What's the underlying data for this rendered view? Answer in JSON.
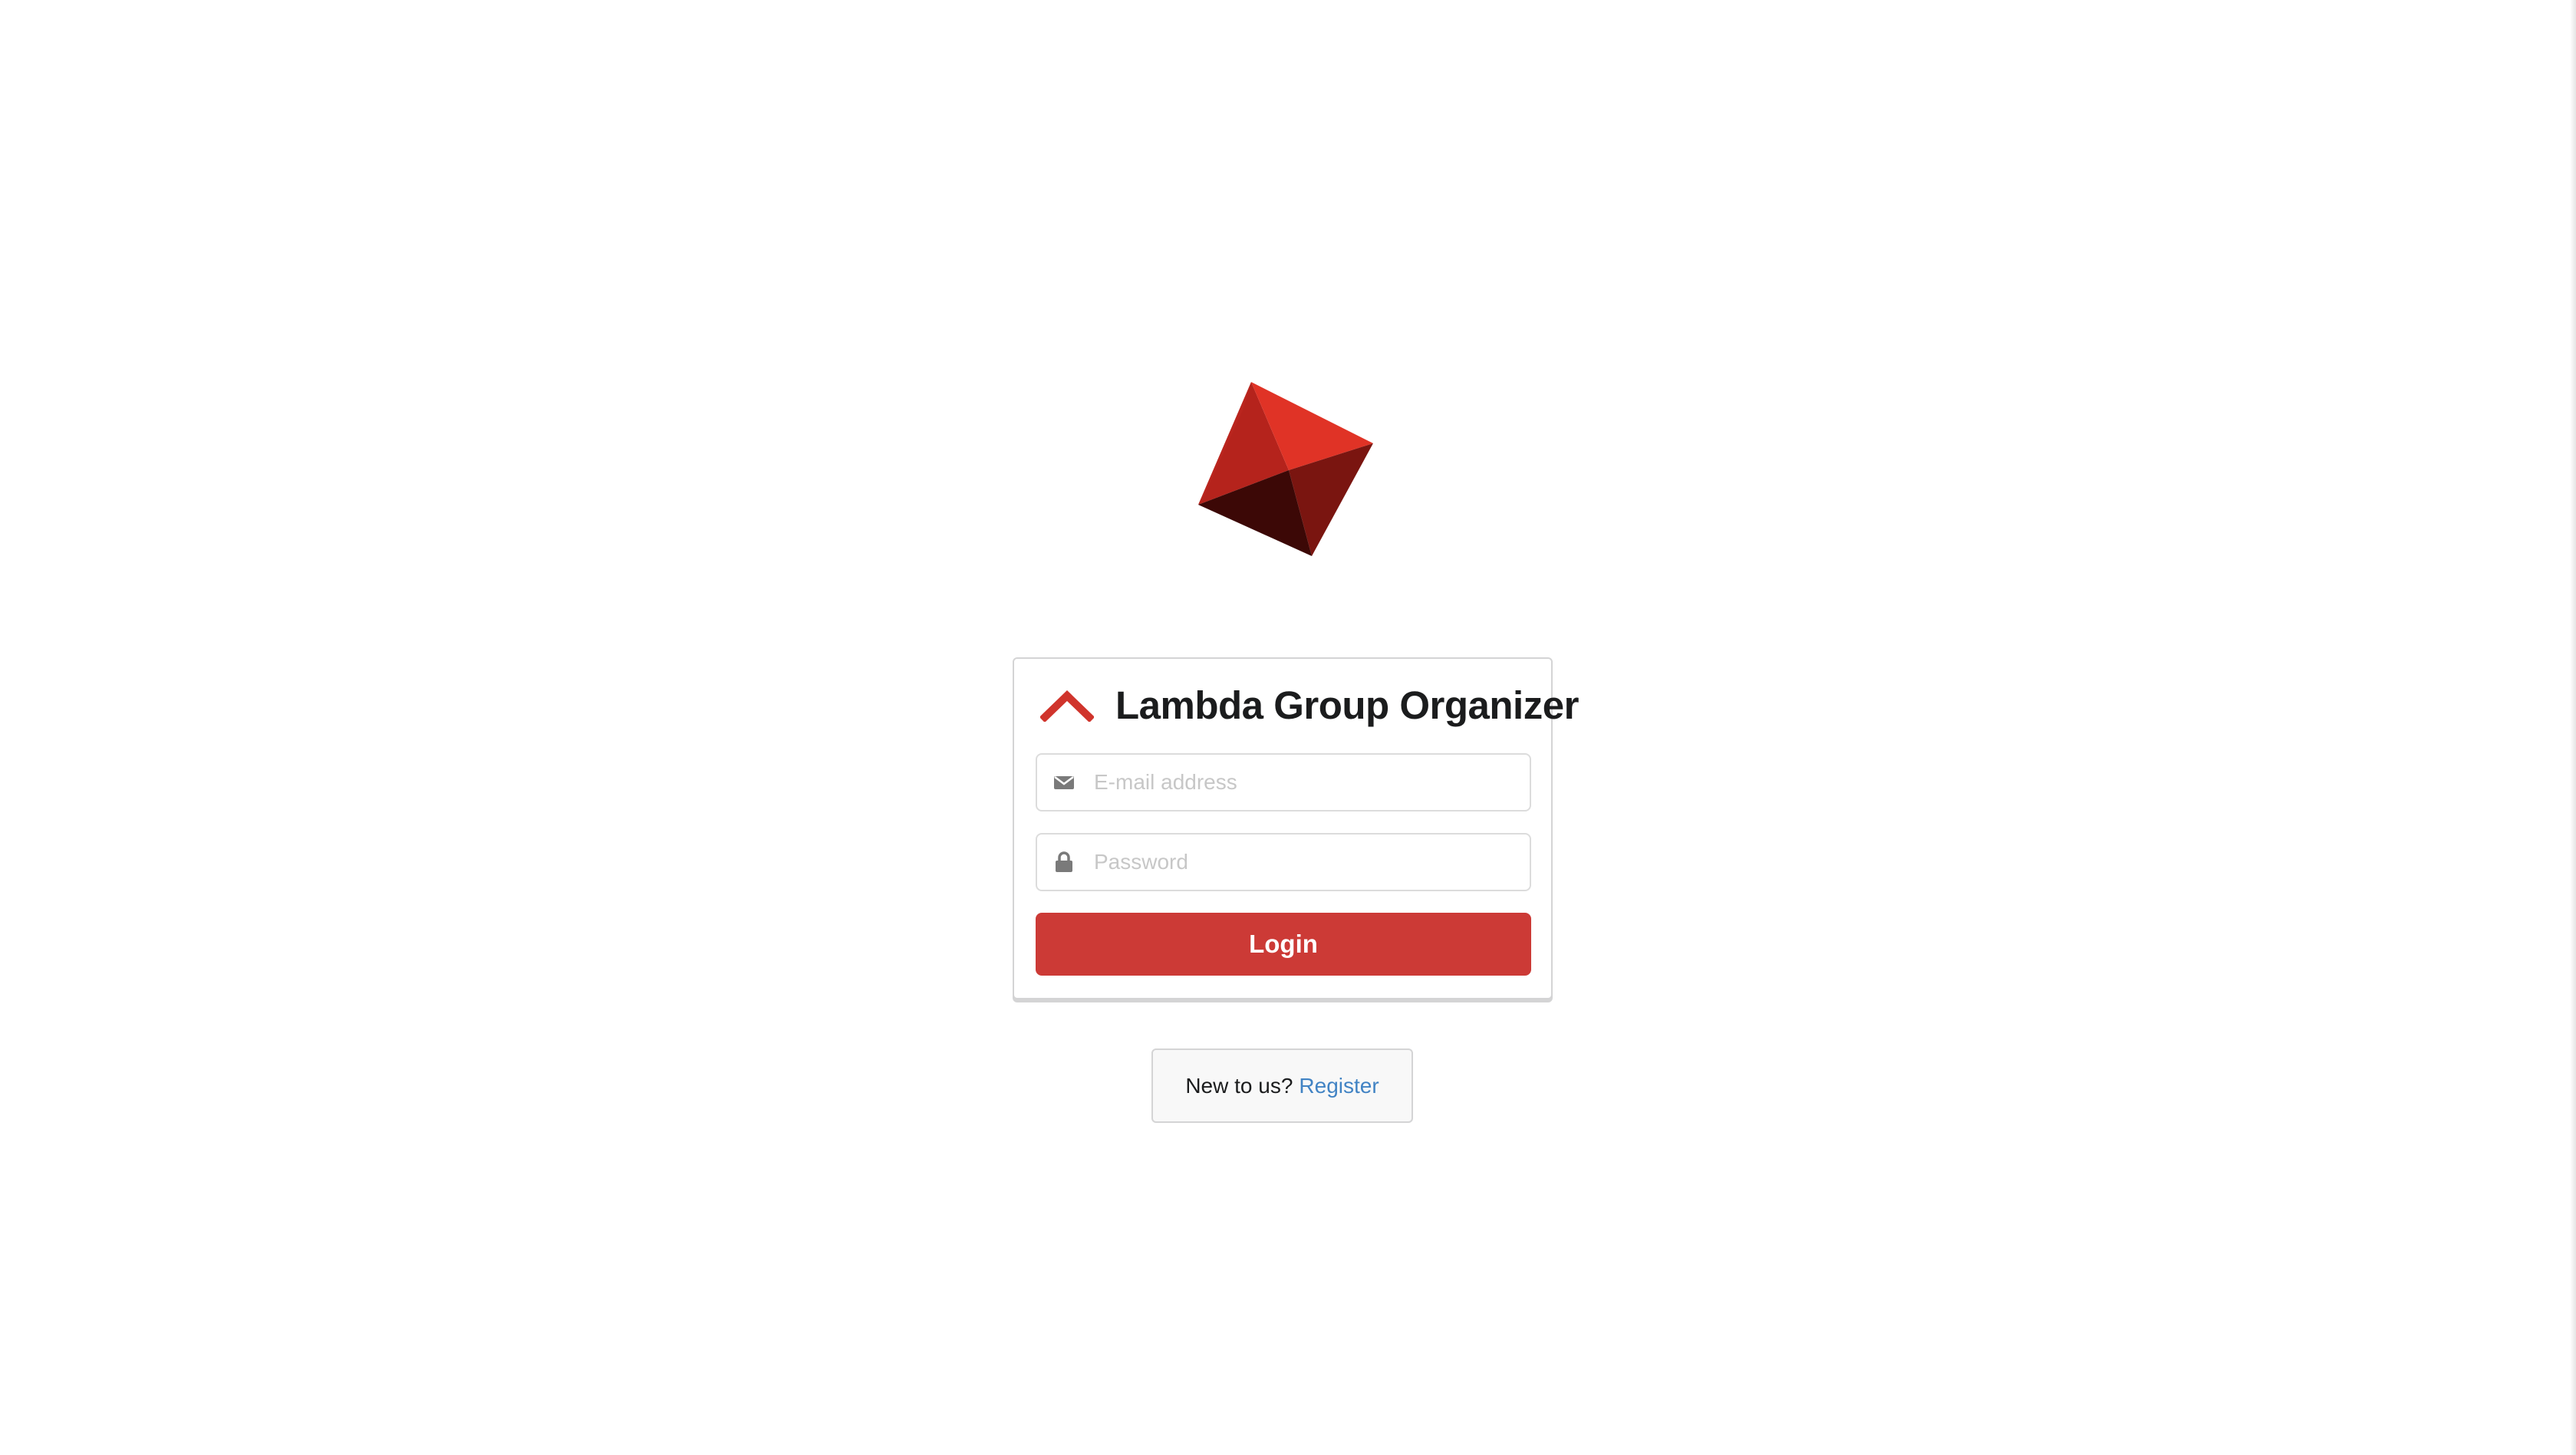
{
  "app": {
    "title": "Lambda Group Organizer"
  },
  "logo": {
    "icon": "red-octahedron-logo",
    "colors": {
      "light": "#e03326",
      "mid": "#b5231c",
      "dark": "#7a1510",
      "darkest": "#3c0806"
    }
  },
  "login_form": {
    "header_icon": "chevron-up-icon",
    "header_icon_color": "#d0342c",
    "email": {
      "icon": "envelope-icon",
      "placeholder": "E-mail address",
      "value": ""
    },
    "password": {
      "icon": "lock-icon",
      "placeholder": "Password",
      "value": ""
    },
    "submit_label": "Login",
    "submit_color": "#cc3a36"
  },
  "register_prompt": {
    "text": "New to us?",
    "link_label": "Register",
    "link_color": "#4183c4"
  }
}
